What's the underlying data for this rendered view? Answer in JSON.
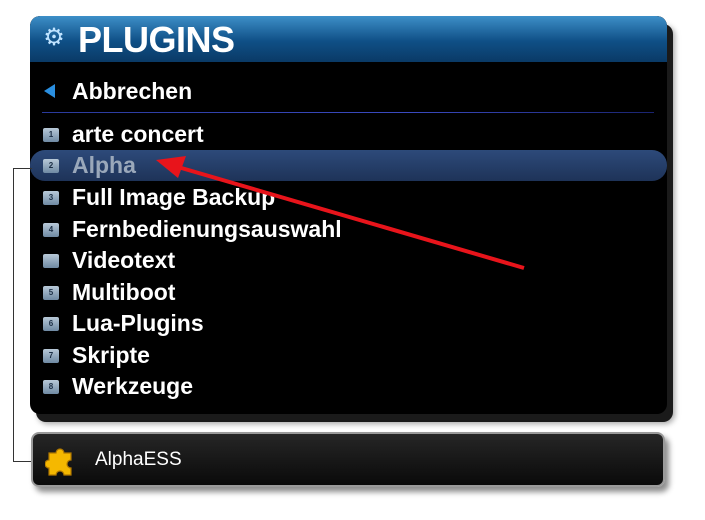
{
  "header": {
    "title": "PLUGINS",
    "icon": "gear-icon"
  },
  "cancel": {
    "label": "Abbrechen",
    "icon": "left-arrow-icon"
  },
  "items": [
    {
      "num": "1",
      "label": "arte concert",
      "selected": false
    },
    {
      "num": "2",
      "label": "Alpha",
      "selected": true
    },
    {
      "num": "3",
      "label": "Full Image Backup",
      "selected": false
    },
    {
      "num": "4",
      "label": "Fernbedienungsauswahl",
      "selected": false
    },
    {
      "num": "",
      "label": "Videotext",
      "selected": false
    },
    {
      "num": "5",
      "label": "Multiboot",
      "selected": false
    },
    {
      "num": "6",
      "label": "Lua-Plugins",
      "selected": false
    },
    {
      "num": "7",
      "label": "Skripte",
      "selected": false
    },
    {
      "num": "8",
      "label": "Werkzeuge",
      "selected": false
    }
  ],
  "footer": {
    "label": "AlphaESS",
    "icon": "puzzle-icon"
  },
  "colors": {
    "accent": "#2a8fe0",
    "annotation_arrow": "#e8141b",
    "selection": "#2d4a7a"
  }
}
